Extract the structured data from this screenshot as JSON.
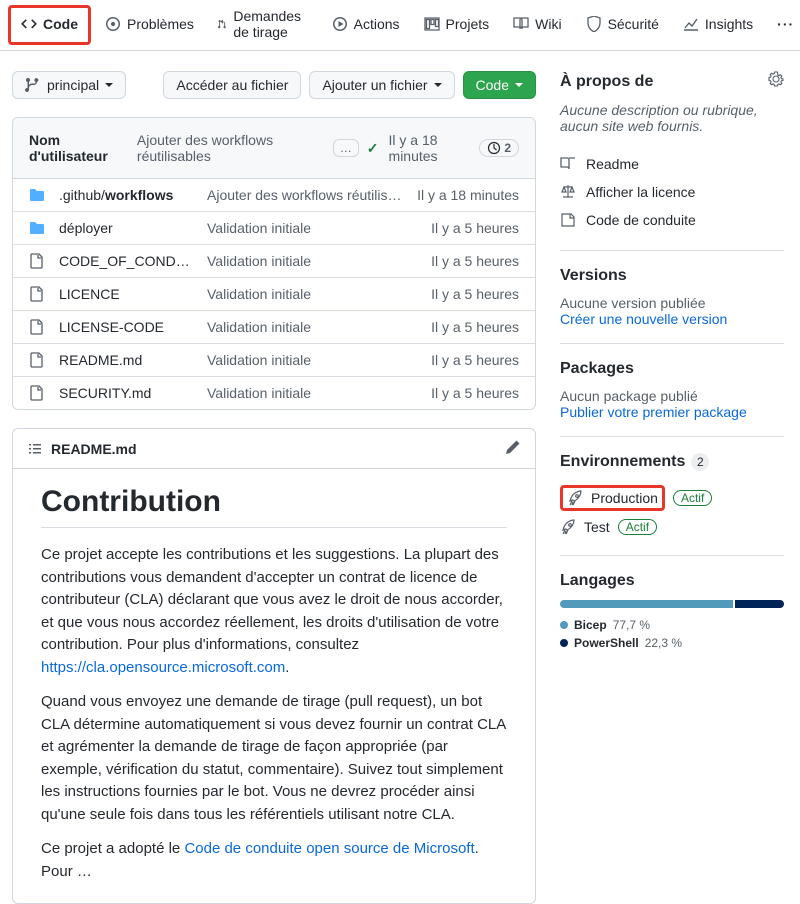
{
  "nav": {
    "code": "Code",
    "issues": "Problèmes",
    "pr": "Demandes de tirage",
    "actions": "Actions",
    "projects": "Projets",
    "wiki": "Wiki",
    "security": "Sécurité",
    "insights": "Insights"
  },
  "toolbar": {
    "branch": "principal",
    "gotofile": "Accéder au fichier",
    "addfile": "Ajouter un fichier",
    "code": "Code"
  },
  "commits": {
    "user": "Nom d'utilisateur",
    "msg": "Ajouter des workflows réutilisables",
    "time": "Il y a 18 minutes",
    "count": "2"
  },
  "files": [
    {
      "type": "folder",
      "name": ".github/workflows",
      "msg": "Ajouter des workflows réutilisables",
      "time": "Il y a 18 minutes",
      "bold": "workflows"
    },
    {
      "type": "folder",
      "name": "déployer",
      "msg": "Validation initiale",
      "time": "Il y a 5 heures"
    },
    {
      "type": "file",
      "name": "CODE_OF_CONDUCT…",
      "msg": "Validation initiale",
      "time": "Il y a 5 heures"
    },
    {
      "type": "file",
      "name": "LICENCE",
      "msg": "Validation initiale",
      "time": "Il y a 5 heures"
    },
    {
      "type": "file",
      "name": "LICENSE-CODE",
      "msg": "Validation initiale",
      "time": "Il y a 5 heures"
    },
    {
      "type": "file",
      "name": "README.md",
      "msg": "Validation initiale",
      "time": "Il y a 5 heures"
    },
    {
      "type": "file",
      "name": "SECURITY.md",
      "msg": "Validation initiale",
      "time": "Il y a 5 heures"
    }
  ],
  "readme": {
    "filename": "README.md",
    "title": "Contribution",
    "p1a": "Ce projet accepte les contributions et les suggestions. La plupart des contributions vous demandent d'accepter un contrat de licence de contributeur (CLA) déclarant que vous avez le droit de nous accorder, et que vous nous accordez réellement, les droits d'utilisation de votre contribution. Pour plus d'informations, consultez ",
    "p1link": "https://cla.opensource.microsoft.com",
    "p1b": ".",
    "p2": "Quand vous envoyez une demande de tirage (pull request), un bot CLA détermine automatiquement si vous devez fournir un contrat CLA et agrémenter la demande de tirage de façon appropriée (par exemple, vérification du statut, commentaire). Suivez tout simplement les instructions fournies par le bot. Vous ne devrez procéder ainsi qu'une seule fois dans tous les référentiels utilisant notre CLA.",
    "p3a": "Ce projet a adopté le ",
    "p3link": "Code de conduite open source de Microsoft",
    "p3b": ". Pour …"
  },
  "about": {
    "heading": "À propos de",
    "desc": "Aucune description ou rubrique, aucun site web fournis.",
    "readme": "Readme",
    "license": "Afficher la licence",
    "coc": "Code de conduite"
  },
  "versions": {
    "heading": "Versions",
    "none": "Aucune version publiée",
    "link": "Créer une nouvelle version"
  },
  "packages": {
    "heading": "Packages",
    "none": "Aucun package publié",
    "link": "Publier votre premier package"
  },
  "environments": {
    "heading": "Environnements",
    "count": "2",
    "items": [
      {
        "name": "Production",
        "status": "Actif",
        "highlighted": true
      },
      {
        "name": "Test",
        "status": "Actif",
        "highlighted": false
      }
    ]
  },
  "languages": {
    "heading": "Langages",
    "items": [
      {
        "name": "Bicep",
        "pct": "77,7 %",
        "color": "#519aba",
        "width": 77.7
      },
      {
        "name": "PowerShell",
        "pct": "22,3 %",
        "color": "#012456",
        "width": 22.3
      }
    ]
  }
}
